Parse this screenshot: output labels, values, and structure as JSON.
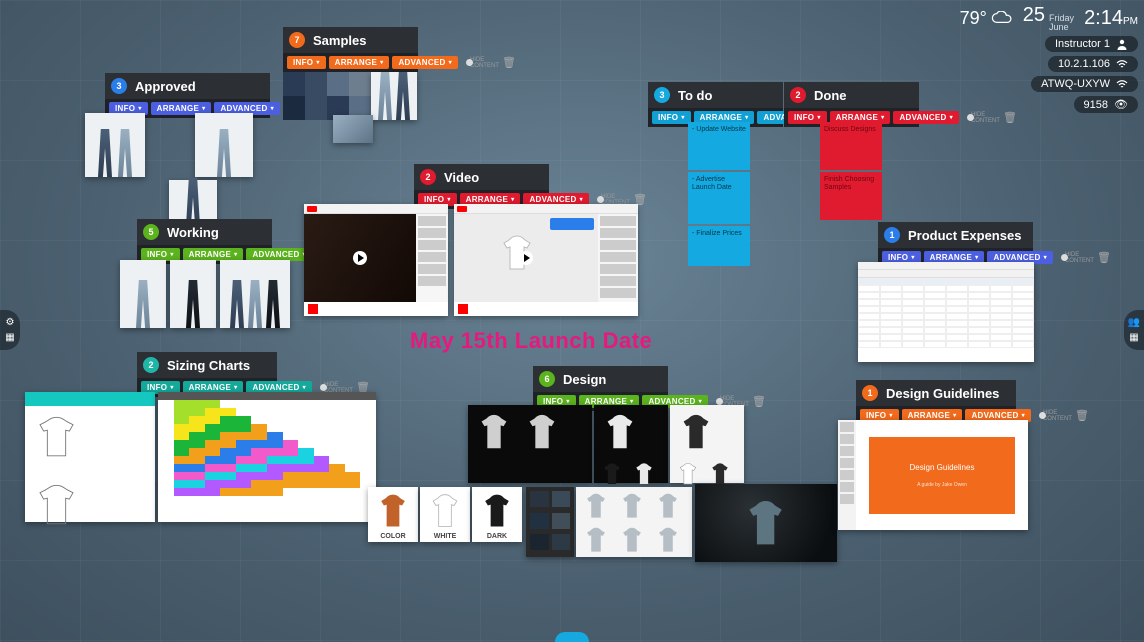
{
  "status": {
    "temperature": "79°",
    "date_day": "25",
    "date_weekday": "Friday",
    "date_month": "June",
    "time": "2:14",
    "time_suffix": "PM",
    "user": "Instructor 1",
    "ip": "10.2.1.106",
    "room_code": "ATWQ-UXYW",
    "counter": "9158"
  },
  "center_text": "May 15th Launch Date",
  "toolbar_labels": {
    "info": "INFO",
    "arrange": "ARRANGE",
    "advanced": "ADVANCED",
    "hide": "HIDE CONTENT"
  },
  "panels": {
    "approved": {
      "num": "3",
      "title": "Approved"
    },
    "samples": {
      "num": "7",
      "title": "Samples"
    },
    "working": {
      "num": "5",
      "title": "Working"
    },
    "video": {
      "num": "2",
      "title": "Video"
    },
    "todo": {
      "num": "3",
      "title": "To do"
    },
    "done": {
      "num": "2",
      "title": "Done"
    },
    "expenses": {
      "num": "1",
      "title": "Product Expenses"
    },
    "sizing": {
      "num": "2",
      "title": "Sizing Charts"
    },
    "design": {
      "num": "6",
      "title": "Design"
    },
    "guidelines": {
      "num": "1",
      "title": "Design Guidelines"
    }
  },
  "todo_items": [
    "- Update Website",
    "- Advertise Launch Date",
    "- Finalize Prices"
  ],
  "done_items": [
    "Discuss Designs",
    "Finish Choosing Samples"
  ],
  "tee_labels": {
    "color": "COLOR",
    "white": "WHITE",
    "dark": "DARK"
  },
  "slide": {
    "title": "Design Guidelines",
    "subtitle": "A guide by Jake Owen"
  }
}
